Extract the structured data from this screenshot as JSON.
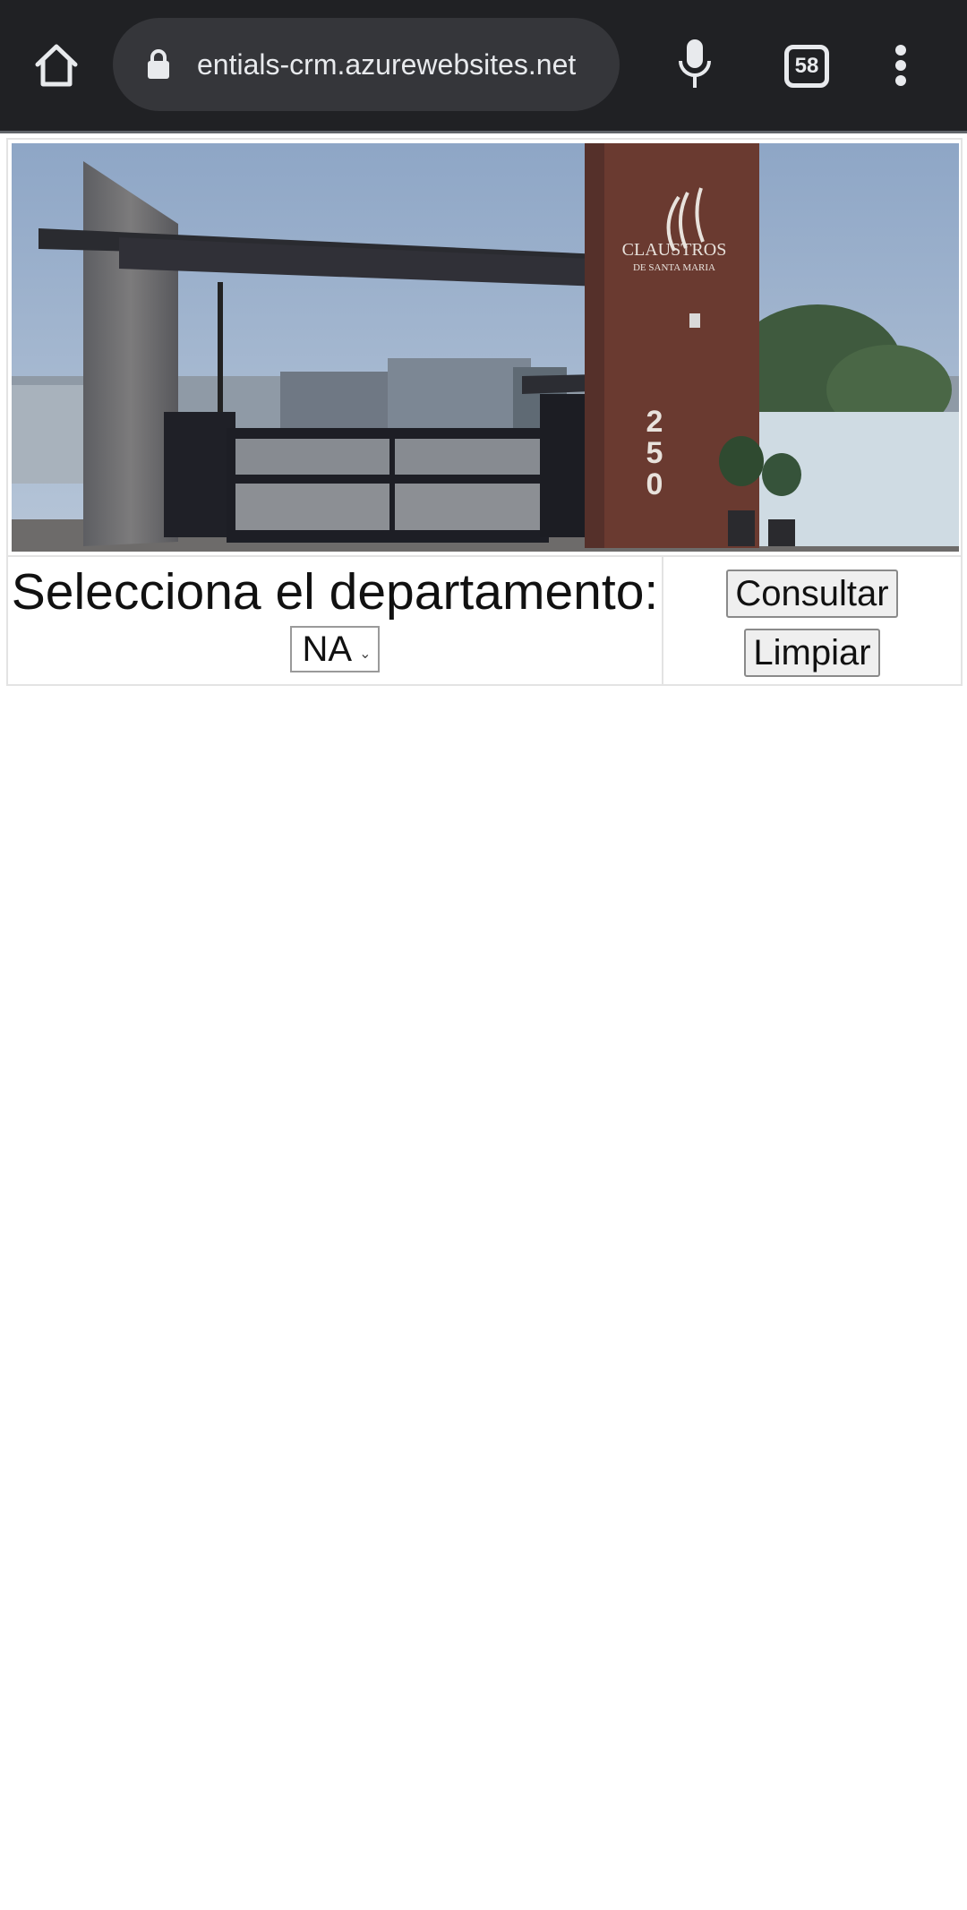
{
  "browser": {
    "url": "credentials-crm.azurewebsites.net",
    "url_visible": "entials-crm.azurewebsites.net",
    "tab_count": "58",
    "icons": [
      "home-icon",
      "lock-icon",
      "microphone-icon",
      "tab-switcher-icon",
      "overflow-menu-icon"
    ],
    "colors": {
      "toolbar_bg": "#202124",
      "omnibox_bg": "#35363a",
      "toolbar_fg": "#e8eaed"
    }
  },
  "banner": {
    "sign_line1": "CLAUSTROS",
    "sign_line2": "DE SANTA MARIA",
    "address_number": "250"
  },
  "form": {
    "prompt": "Selecciona el departamento:",
    "department_selected": "NA",
    "consultar_label": "Consultar",
    "limpiar_label": "Limpiar"
  }
}
